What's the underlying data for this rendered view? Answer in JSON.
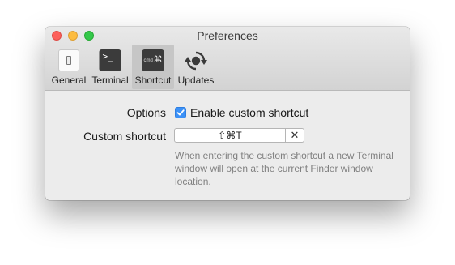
{
  "window": {
    "title": "Preferences"
  },
  "toolbar": {
    "items": [
      {
        "label": "General",
        "icon": "switch-icon",
        "selected": false
      },
      {
        "label": "Terminal",
        "icon": "terminal-icon",
        "icon_text": ">_",
        "selected": false
      },
      {
        "label": "Shortcut",
        "icon": "command-key-icon",
        "icon_text": "cmd",
        "icon_symbol": "⌘",
        "selected": true
      },
      {
        "label": "Updates",
        "icon": "refresh-icon",
        "selected": false
      }
    ]
  },
  "options": {
    "label": "Options",
    "checkbox_label": "Enable custom shortcut",
    "checked": true
  },
  "shortcut": {
    "label": "Custom shortcut",
    "value": "⇧⌘T",
    "clear_symbol": "✕",
    "help_text": "When entering the custom shortcut a new Terminal window will open at the current Finder window location."
  },
  "colors": {
    "accent": "#3b91f7",
    "close": "#fc605b",
    "minimize": "#fdbc40",
    "zoom": "#34c84a"
  }
}
